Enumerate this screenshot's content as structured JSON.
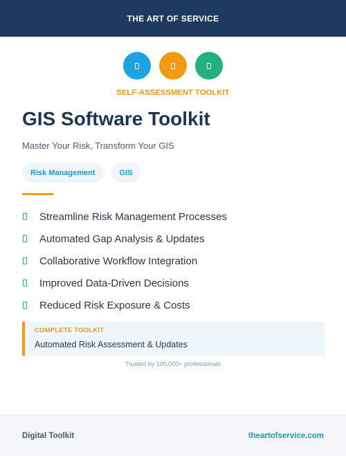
{
  "header": {
    "brand": "THE ART OF SERVICE"
  },
  "icons": [
    {
      "name": "document-icon",
      "color": "#1ca3e6"
    },
    {
      "name": "document-icon",
      "color": "#f29a17"
    },
    {
      "name": "document-icon",
      "color": "#22b07d"
    }
  ],
  "kicker": "SELF-ASSESSMENT TOOLKIT",
  "title": "GIS Software Toolkit",
  "subtitle": "Master Your Risk, Transform Your GIS",
  "tags": [
    "Risk Management",
    "GIS"
  ],
  "features": [
    "Streamline Risk Management Processes",
    "Automated Gap Analysis & Updates",
    "Collaborative Workflow Integration",
    "Improved Data-Driven Decisions",
    "Reduced Risk Exposure & Costs"
  ],
  "callout": {
    "kicker": "COMPLETE TOOLKIT",
    "text": "Automated Risk Assessment & Updates"
  },
  "trusted": "Trusted by 100,000+ professionals",
  "footer": {
    "left": "Digital Toolkit",
    "right": "theartofservice.com"
  },
  "colors": {
    "navy": "#1e3a5f",
    "accent_orange": "#f29a17",
    "accent_blue": "#1a97dc",
    "accent_green": "#22b07d"
  }
}
